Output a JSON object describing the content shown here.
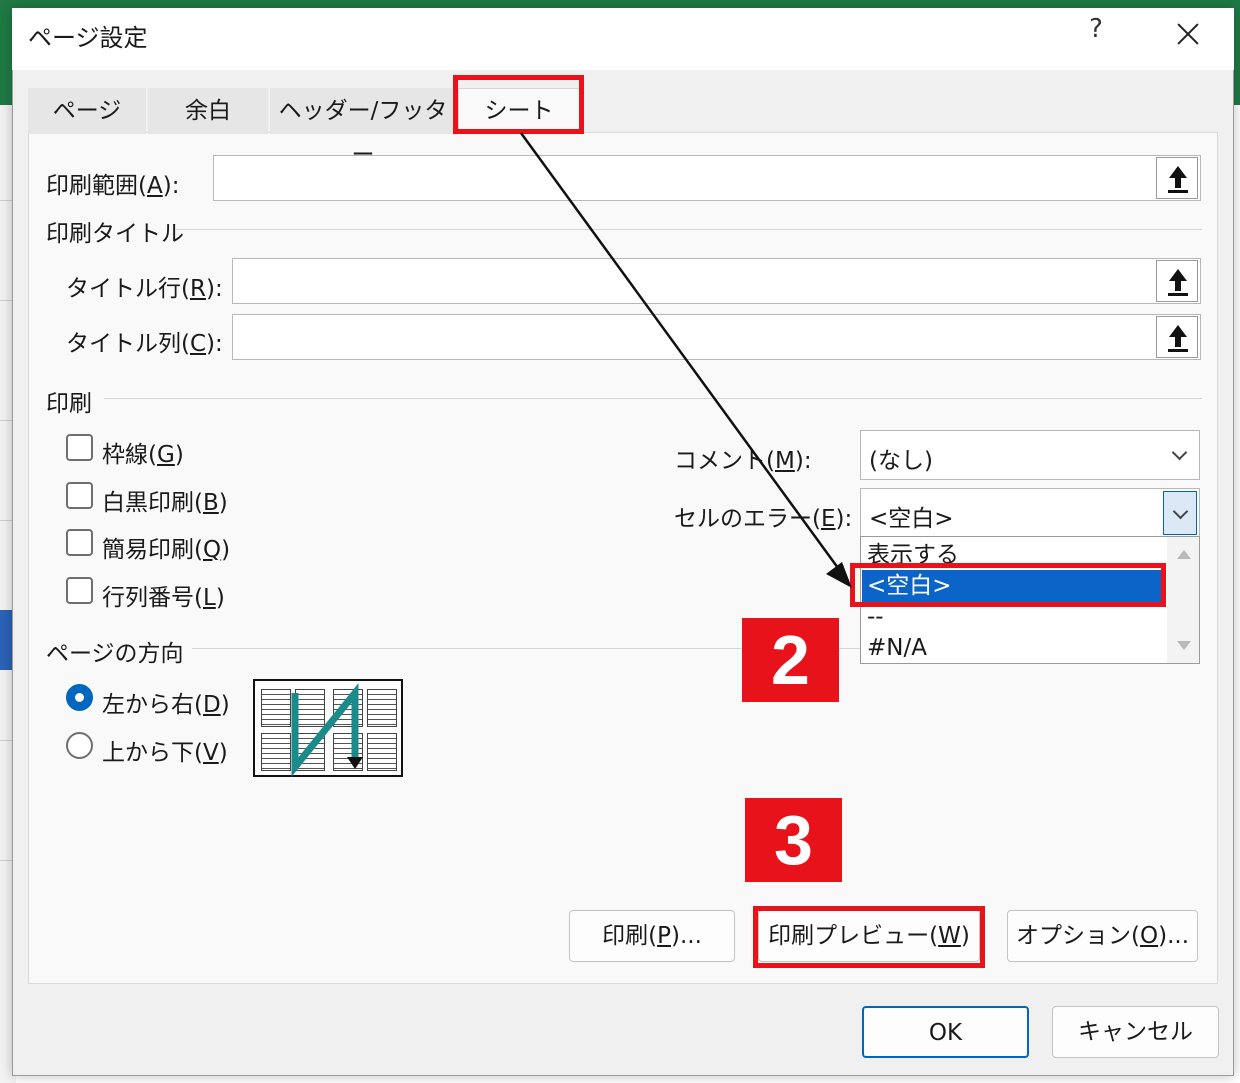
{
  "dialog": {
    "title": "ページ設定",
    "help": "?"
  },
  "tabs": [
    {
      "label": "ページ"
    },
    {
      "label": "余白"
    },
    {
      "label": "ヘッダー/フッター"
    },
    {
      "label": "シート",
      "active": true
    }
  ],
  "print_area": {
    "label_pre": "印刷範囲(",
    "key": "A",
    "label_post": "):",
    "value": ""
  },
  "print_titles": {
    "heading": "印刷タイトル",
    "rows": {
      "label_pre": "タイトル行(",
      "key": "R",
      "label_post": "):",
      "value": ""
    },
    "cols": {
      "label_pre": "タイトル列(",
      "key": "C",
      "label_post": "):",
      "value": ""
    }
  },
  "print": {
    "heading": "印刷",
    "checkboxes": [
      {
        "pre": "枠線(",
        "key": "G",
        "post": ")",
        "checked": false
      },
      {
        "pre": "白黒印刷(",
        "key": "B",
        "post": ")",
        "checked": false
      },
      {
        "pre": "簡易印刷(",
        "key": "Q",
        "post": ")",
        "checked": false
      },
      {
        "pre": "行列番号(",
        "key": "L",
        "post": ")",
        "checked": false
      }
    ],
    "comments": {
      "pre": "コメント(",
      "key": "M",
      "post": "):",
      "value": "(なし)"
    },
    "cell_errors": {
      "pre": "セルのエラー(",
      "key": "E",
      "post": "):",
      "value": "<空白>"
    },
    "cell_error_options": [
      "表示する",
      "<空白>",
      "--",
      "#N/A"
    ],
    "cell_error_selected": "<空白>"
  },
  "page_order": {
    "heading": "ページの方向",
    "options": [
      {
        "pre": "左から右(",
        "key": "D",
        "post": ")",
        "selected": true
      },
      {
        "pre": "上から下(",
        "key": "V",
        "post": ")",
        "selected": false
      }
    ]
  },
  "buttons": {
    "print": {
      "pre": "印刷(",
      "key": "P",
      "post": ")..."
    },
    "preview": {
      "pre": "印刷プレビュー(",
      "key": "W",
      "post": ")"
    },
    "options": {
      "pre": "オプション(",
      "key": "O",
      "post": ")..."
    },
    "ok": "OK",
    "cancel": "キャンセル"
  },
  "annotations": {
    "step2": "2",
    "step3": "3",
    "highlight_color": "#e8121a"
  }
}
